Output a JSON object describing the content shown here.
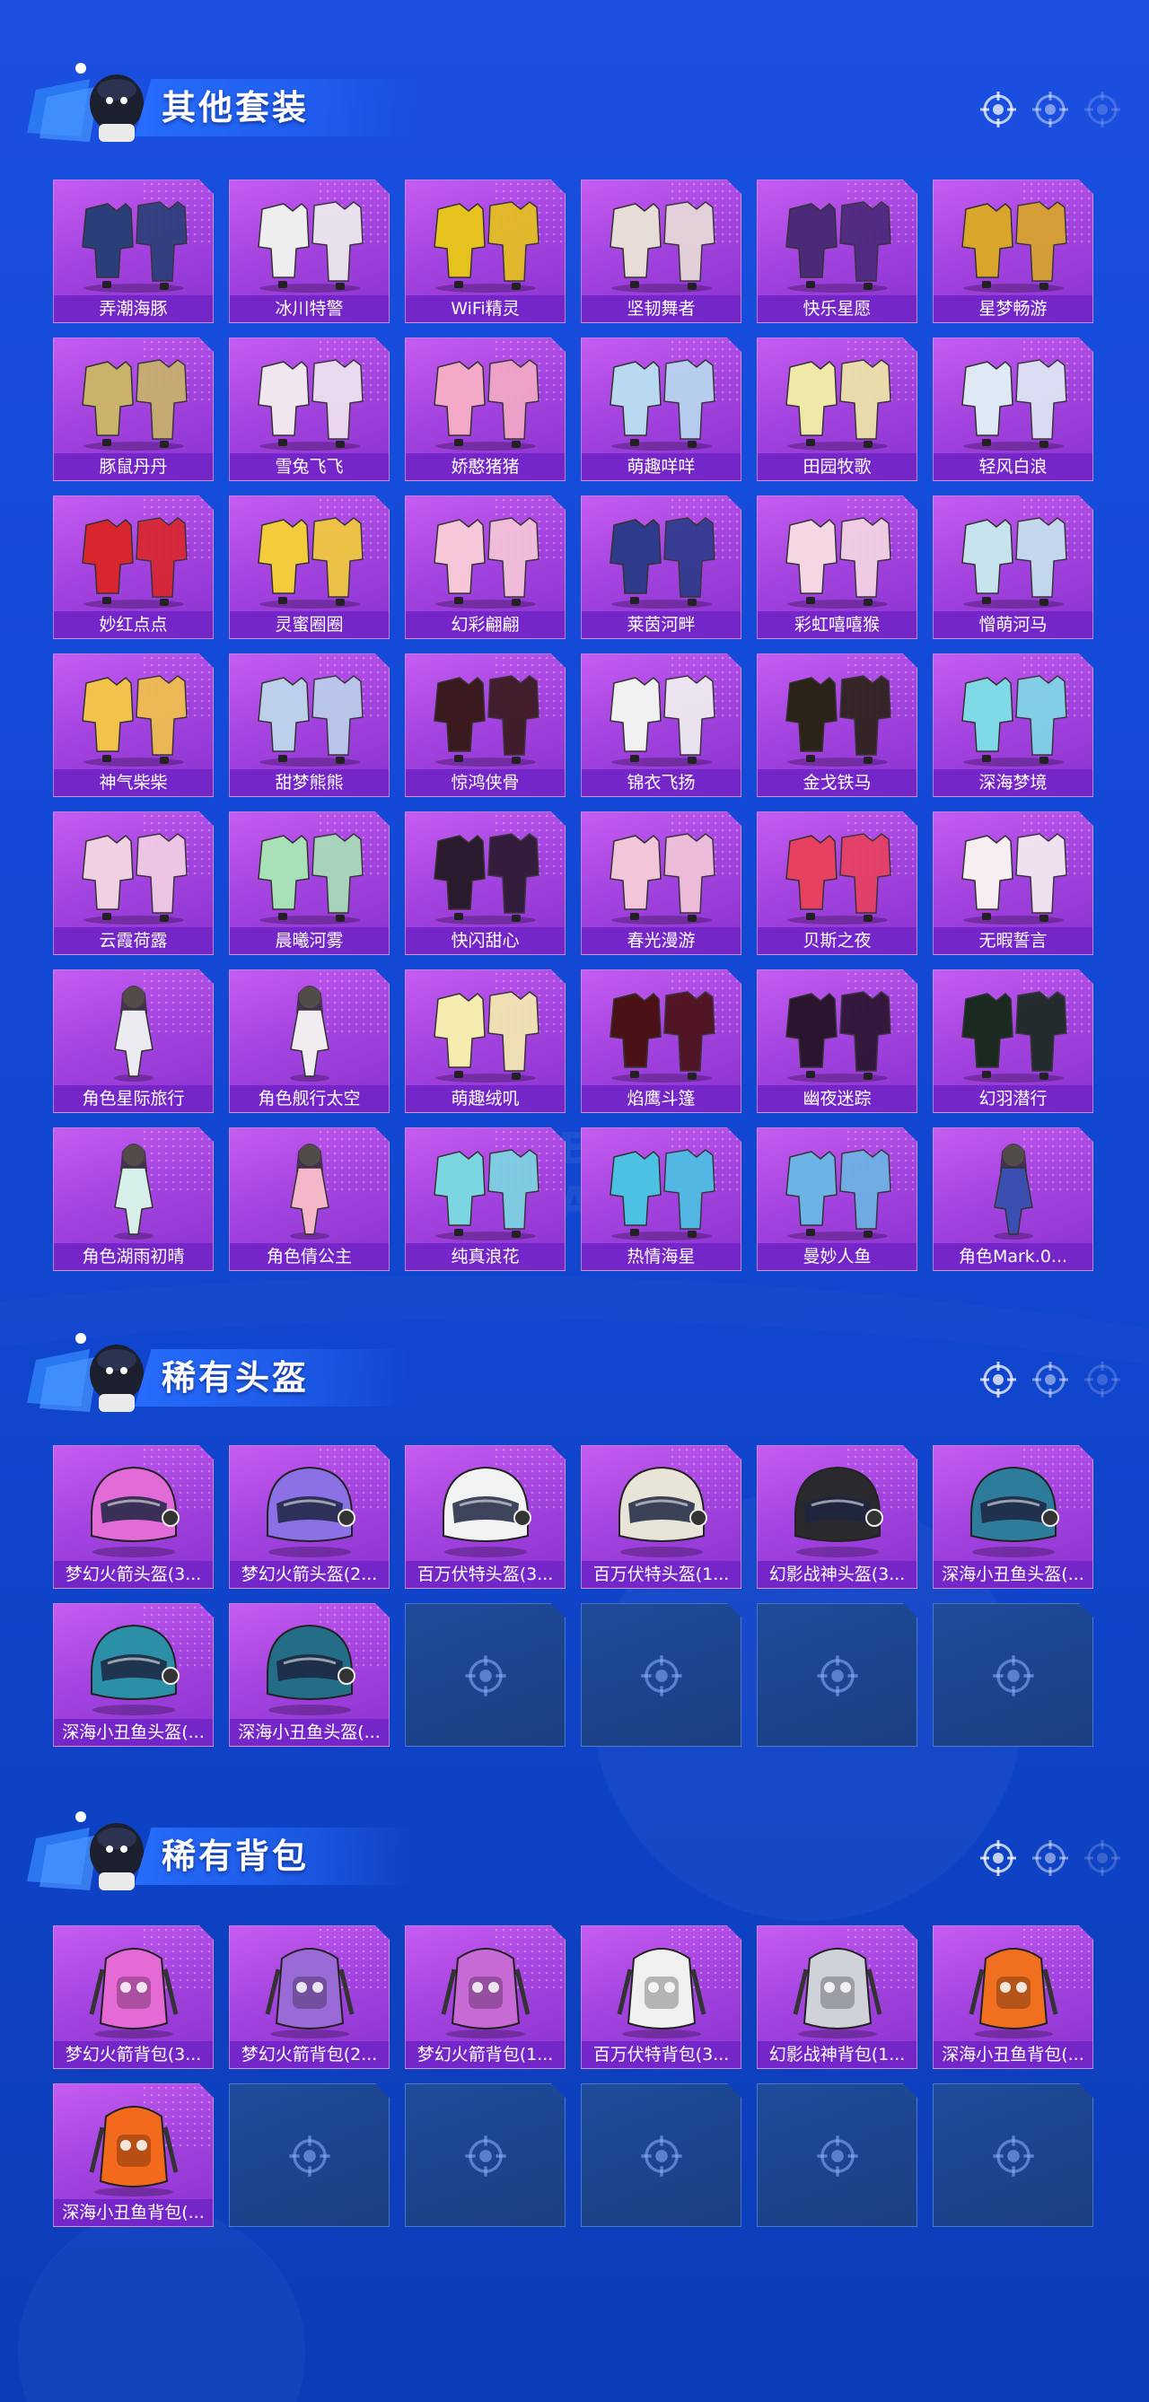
{
  "colors": {
    "background": "#1349d6",
    "tile_purple": "#a544e0",
    "label_purple": "#7426c9",
    "empty_tile": "#1e4b9a"
  },
  "watermark": {
    "line1": "",
    "line2": "GAME FOR PEACE"
  },
  "sections": [
    {
      "title": "其他套装",
      "items": [
        {
          "name": "弄潮海豚",
          "icon": "outfit-icon",
          "tint": "#2a3f7a"
        },
        {
          "name": "冰川特警",
          "icon": "outfit-icon",
          "tint": "#eeeeee"
        },
        {
          "name": "WiFi精灵",
          "icon": "outfit-icon",
          "tint": "#e6c21e"
        },
        {
          "name": "坚韧舞者",
          "icon": "outfit-icon",
          "tint": "#e8dcd8"
        },
        {
          "name": "快乐星愿",
          "icon": "outfit-icon",
          "tint": "#4b2a7a"
        },
        {
          "name": "星梦畅游",
          "icon": "outfit-icon",
          "tint": "#d9a52a"
        },
        {
          "name": "豚鼠丹丹",
          "icon": "outfit-icon",
          "tint": "#c9b36a"
        },
        {
          "name": "雪兔飞飞",
          "icon": "outfit-icon",
          "tint": "#f0e6ef"
        },
        {
          "name": "娇憨猪猪",
          "icon": "outfit-icon",
          "tint": "#f4a9c6"
        },
        {
          "name": "萌趣咩咩",
          "icon": "outfit-icon",
          "tint": "#b9d9f0"
        },
        {
          "name": "田园牧歌",
          "icon": "outfit-icon",
          "tint": "#f0e8a8"
        },
        {
          "name": "轻风白浪",
          "icon": "outfit-icon",
          "tint": "#dfe9f5"
        },
        {
          "name": "妙红点点",
          "icon": "outfit-icon",
          "tint": "#d9262e"
        },
        {
          "name": "灵蜜圈圈",
          "icon": "outfit-icon",
          "tint": "#f2cc3a"
        },
        {
          "name": "幻彩翩翩",
          "icon": "outfit-icon",
          "tint": "#f7c6d8"
        },
        {
          "name": "莱茵河畔",
          "icon": "outfit-icon",
          "tint": "#2e3b8c"
        },
        {
          "name": "彩虹嘻嘻猴",
          "icon": "outfit-icon",
          "tint": "#f5d7e4"
        },
        {
          "name": "憎萌河马",
          "icon": "outfit-icon",
          "tint": "#c6e3ee"
        },
        {
          "name": "神气柴柴",
          "icon": "outfit-icon",
          "tint": "#f2c24a"
        },
        {
          "name": "甜梦熊熊",
          "icon": "outfit-icon",
          "tint": "#bcd0ec"
        },
        {
          "name": "惊鸿侠骨",
          "icon": "outfit-icon",
          "tint": "#3a1a1e"
        },
        {
          "name": "锦衣飞扬",
          "icon": "outfit-icon",
          "tint": "#f1f1f1"
        },
        {
          "name": "金戈铁马",
          "icon": "outfit-icon",
          "tint": "#2b2218"
        },
        {
          "name": "深海梦境",
          "icon": "outfit-icon",
          "tint": "#7fd9e6"
        },
        {
          "name": "云霞荷露",
          "icon": "outfit-icon",
          "tint": "#f2d0e4"
        },
        {
          "name": "晨曦河雾",
          "icon": "outfit-icon",
          "tint": "#a8e0b8"
        },
        {
          "name": "快闪甜心",
          "icon": "outfit-icon",
          "tint": "#2a1a2e"
        },
        {
          "name": "春光漫游",
          "icon": "outfit-icon",
          "tint": "#f2c6d8"
        },
        {
          "name": "贝斯之夜",
          "icon": "outfit-icon",
          "tint": "#e84060"
        },
        {
          "name": "无暇誓言",
          "icon": "outfit-icon",
          "tint": "#f6eef0"
        },
        {
          "name": "角色星际旅行",
          "icon": "character-icon",
          "tint": "#ecebf1"
        },
        {
          "name": "角色舰行太空",
          "icon": "character-icon",
          "tint": "#f1ecef"
        },
        {
          "name": "萌趣绒叽",
          "icon": "outfit-icon",
          "tint": "#f6ecb0"
        },
        {
          "name": "焰鹰斗篷",
          "icon": "outfit-icon",
          "tint": "#4a1216"
        },
        {
          "name": "幽夜迷踪",
          "icon": "outfit-icon",
          "tint": "#2a1430"
        },
        {
          "name": "幻羽潜行",
          "icon": "outfit-icon",
          "tint": "#1a2a20"
        },
        {
          "name": "角色湖雨初晴",
          "icon": "character-icon",
          "tint": "#d8f0ea"
        },
        {
          "name": "角色倩公主",
          "icon": "character-icon",
          "tint": "#f4b6c8"
        },
        {
          "name": "纯真浪花",
          "icon": "outfit-icon",
          "tint": "#7cd6e2"
        },
        {
          "name": "热情海星",
          "icon": "outfit-icon",
          "tint": "#4cc1e4"
        },
        {
          "name": "曼妙人鱼",
          "icon": "outfit-icon",
          "tint": "#6db4e6"
        },
        {
          "name": "角色Mark.0...",
          "icon": "character-icon",
          "tint": "#3a4fb0"
        }
      ],
      "empty_slots": 0
    },
    {
      "title": "稀有头盔",
      "items": [
        {
          "name": "梦幻火箭头盔(3...",
          "icon": "helmet-icon",
          "tint": "#e26bd7"
        },
        {
          "name": "梦幻火箭头盔(2...",
          "icon": "helmet-icon",
          "tint": "#8c70e6"
        },
        {
          "name": "百万伏特头盔(3...",
          "icon": "helmet-icon",
          "tint": "#f3f3f3"
        },
        {
          "name": "百万伏特头盔(1...",
          "icon": "helmet-icon",
          "tint": "#e8e4d8"
        },
        {
          "name": "幻影战神头盔(3...",
          "icon": "helmet-icon",
          "tint": "#2a2a2e"
        },
        {
          "name": "深海小丑鱼头盔(...",
          "icon": "helmet-icon",
          "tint": "#2e7c9c"
        },
        {
          "name": "深海小丑鱼头盔(...",
          "icon": "helmet-icon",
          "tint": "#2b8fa8"
        },
        {
          "name": "深海小丑鱼头盔(...",
          "icon": "helmet-icon",
          "tint": "#236d86"
        }
      ],
      "empty_slots": 4
    },
    {
      "title": "稀有背包",
      "items": [
        {
          "name": "梦幻火箭背包(3...",
          "icon": "backpack-icon",
          "tint": "#e66ad6"
        },
        {
          "name": "梦幻火箭背包(2...",
          "icon": "backpack-icon",
          "tint": "#9a6ad6"
        },
        {
          "name": "梦幻火箭背包(1...",
          "icon": "backpack-icon",
          "tint": "#c86ad6"
        },
        {
          "name": "百万伏特背包(3...",
          "icon": "backpack-icon",
          "tint": "#f0f0f0"
        },
        {
          "name": "幻影战神背包(1...",
          "icon": "backpack-icon",
          "tint": "#cfd3d9"
        },
        {
          "name": "深海小丑鱼背包(...",
          "icon": "backpack-icon",
          "tint": "#f07020"
        },
        {
          "name": "深海小丑鱼背包(...",
          "icon": "backpack-icon",
          "tint": "#f46a1c"
        }
      ],
      "empty_slots": 5
    }
  ]
}
